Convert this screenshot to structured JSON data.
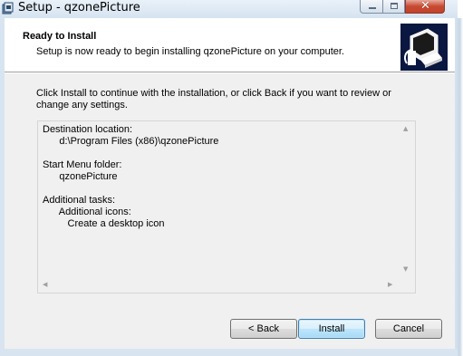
{
  "window": {
    "title": "Setup - qzonePicture",
    "minimize_label": "",
    "maximize_label": "",
    "close_label": "✕"
  },
  "header": {
    "title": "Ready to Install",
    "subtitle": "Setup is now ready to begin installing qzonePicture on your computer."
  },
  "body": {
    "instructions": "Click Install to continue with the installation, or click Back if you want to review or change any settings."
  },
  "memo": {
    "lines": [
      "Destination location:",
      "      d:\\Program Files (x86)\\qzonePicture",
      "",
      "Start Menu folder:",
      "      qzonePicture",
      "",
      "Additional tasks:",
      "      Additional icons:",
      "         Create a desktop icon"
    ]
  },
  "buttons": {
    "back": "< Back",
    "install": "Install",
    "cancel": "Cancel"
  },
  "colors": {
    "install_button_border": "#3c7fb1",
    "close_button": "#c74a32",
    "wizard_image_bg": "#0a1740"
  }
}
